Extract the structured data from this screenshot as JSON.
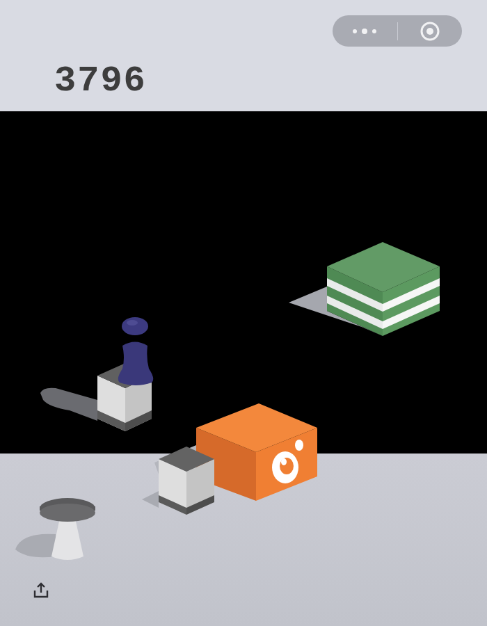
{
  "score": "3796"
}
